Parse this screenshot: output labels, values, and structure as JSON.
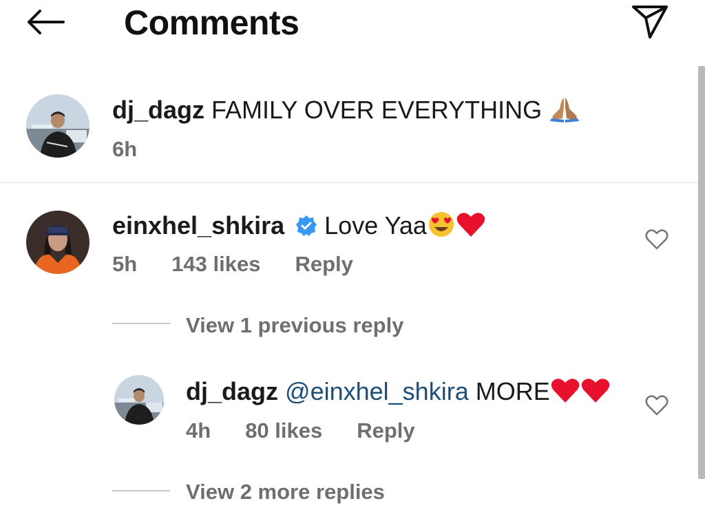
{
  "header": {
    "title": "Comments",
    "back_icon": "arrow-left-icon",
    "share_icon": "paper-plane-icon"
  },
  "caption": {
    "username": "dj_dagz",
    "text": "FAMILY OVER EVERYTHING",
    "emoji": "folded-hands-emoji",
    "time": "6h"
  },
  "comments": [
    {
      "username": "einxhel_shkira",
      "verified": true,
      "text": "Love Yaa",
      "emojis": [
        "heart-eyes-emoji",
        "red-heart-emoji"
      ],
      "time": "5h",
      "likes": "143 likes",
      "reply_label": "Reply",
      "view_previous": "View 1 previous reply",
      "reply": {
        "username": "dj_dagz",
        "mention": "@einxhel_shkira",
        "text": "MORE",
        "emojis": [
          "red-heart-emoji",
          "red-heart-emoji"
        ],
        "time": "4h",
        "likes": "80 likes",
        "reply_label": "Reply"
      },
      "view_more": "View 2 more replies"
    }
  ],
  "colors": {
    "text": "#1a1a1a",
    "meta": "#6f6f6f",
    "mention": "#1d4e78",
    "verified": "#3897f0",
    "heart": "#e8112d"
  }
}
